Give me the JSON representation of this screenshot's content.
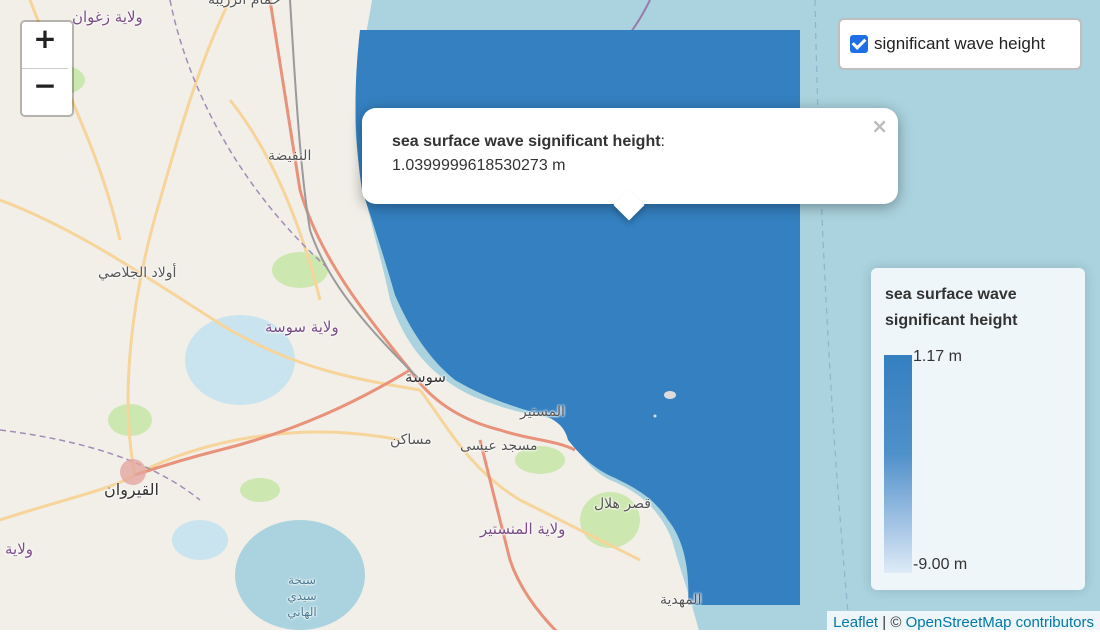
{
  "zoom": {
    "in_label": "+",
    "out_label": "−"
  },
  "layer_control": {
    "checked": true,
    "label": "significant wave height"
  },
  "popup": {
    "title": "sea surface wave significant height",
    "title_suffix": ":",
    "value": "1.0399999618530273 m",
    "close_label": "×"
  },
  "legend": {
    "title": "sea surface wave significant height",
    "max_label": "1.17 m",
    "min_label": "-9.00 m",
    "colors": [
      "#3480c0",
      "#4f90ca",
      "#a9c7e6",
      "#deebf7"
    ]
  },
  "attribution": {
    "leaflet": "Leaflet",
    "separator": " | © ",
    "osm": "OpenStreetMap contributors"
  },
  "places": {
    "p1": "حمام الزريبة",
    "p2": "ولاية زغوان",
    "p3": "النفيضة",
    "p4": "أولاد الجلاصي",
    "p5": "ولاية سوسة",
    "p6": "سوسة",
    "p7": "المستير",
    "p8": "مساكن",
    "p9": "مسجد عيسى",
    "p10": "القيروان",
    "p11": "قصر هلال",
    "p12": "ولاية المنستير",
    "p13": "ولاية",
    "p14": "سبخة سيدي الهاني",
    "p15": "المهدية"
  },
  "colors": {
    "sea": "#aad3df",
    "land": "#f2efe9",
    "overlay": "#3480c0",
    "primary_road": "#e8927c",
    "secondary_road": "#f6d49a"
  }
}
